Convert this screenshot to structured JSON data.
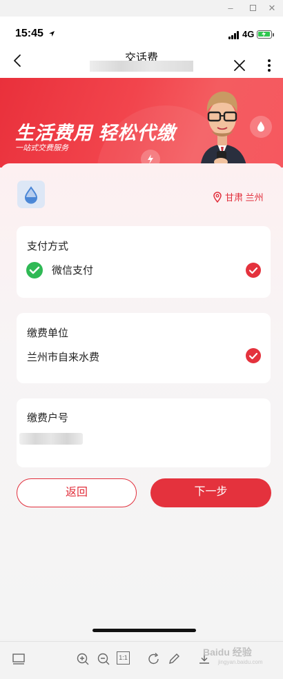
{
  "status_bar": {
    "time": "15:45",
    "network": "4G"
  },
  "nav": {
    "title": "交话费"
  },
  "banner": {
    "title": "生活费用 轻松代缴",
    "subtitle": "一站式交费服务"
  },
  "location": {
    "text": "甘肃 兰州"
  },
  "payment_method": {
    "label": "支付方式",
    "value": "微信支付"
  },
  "payment_unit": {
    "label": "缴费单位",
    "value": "兰州市自来水费"
  },
  "account": {
    "label": "缴费户号"
  },
  "buttons": {
    "back": "返回",
    "next": "下一步"
  },
  "toolbar": {
    "ratio_label": "1:1"
  },
  "watermark": {
    "text": "Baidu 经验",
    "sub": "jingyan.baidu.com"
  },
  "colors": {
    "accent": "#e4323d",
    "wechat": "#2fb955",
    "battery": "#2fc64f"
  }
}
